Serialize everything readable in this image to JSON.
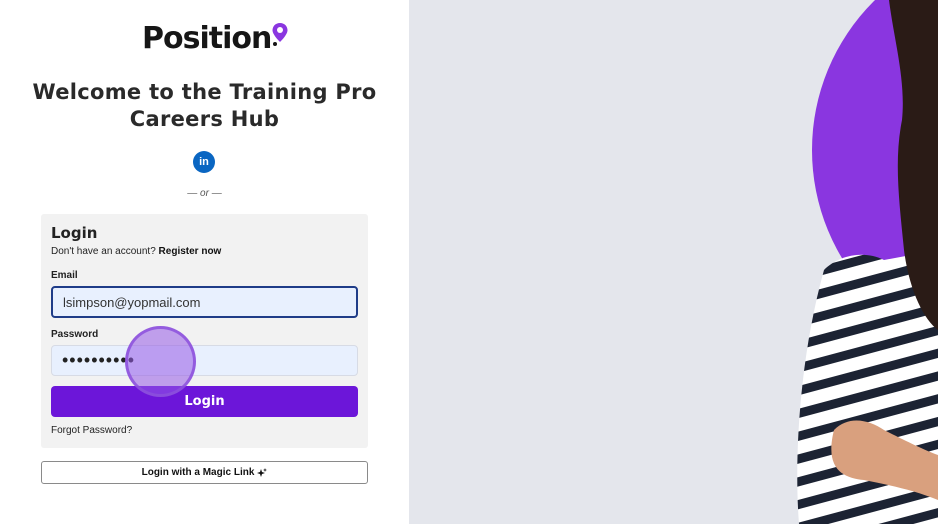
{
  "brand": {
    "logo_text": "Position",
    "accent_color": "#6c16d9"
  },
  "header": {
    "title": "Welcome to the Training Pro Careers Hub"
  },
  "social": {
    "linkedin_label": "in",
    "divider_text": "— or —"
  },
  "login_form": {
    "title": "Login",
    "register_prompt": "Don't have an account?",
    "register_link": "Register now",
    "email_label": "Email",
    "email_value": "lsimpson@yopmail.com",
    "password_label": "Password",
    "password_value": "••••••••••",
    "submit_label": "Login",
    "forgot_link": "Forgot Password?"
  },
  "magic_link": {
    "label": "Login with a Magic Link",
    "icon": "sparkle-icon"
  },
  "hero": {
    "circle_color": "#8a36e0",
    "background_color": "#e4e6ec"
  }
}
